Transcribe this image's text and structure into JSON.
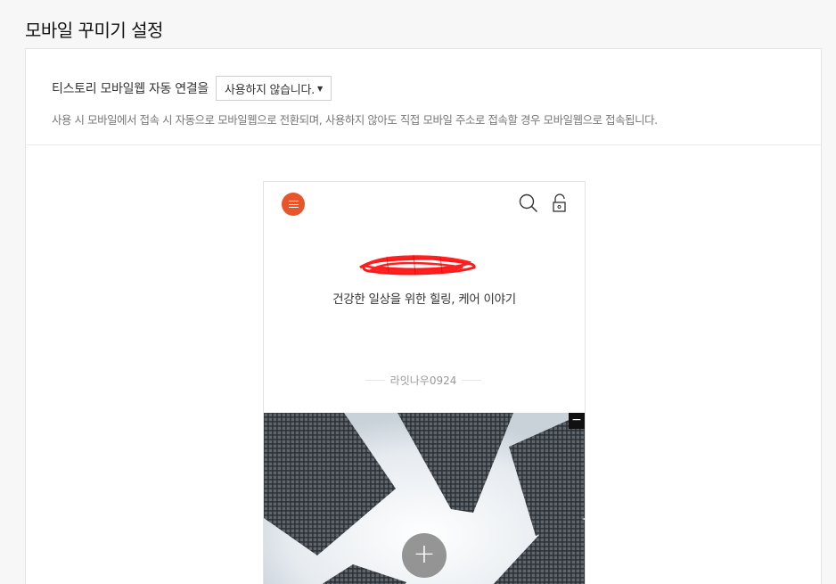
{
  "page": {
    "title": "모바일 꾸미기 설정"
  },
  "setting": {
    "label": "티스토리 모바일웹 자동 연결을",
    "select_value": "사용하지 않습니다.",
    "description": "사용 시 모바일에서 접속 시 자동으로 모바일웹으로 전환되며, 사용하지 않아도 직접 모바일 주소로 접속할 경우 모바일웹으로 접속됩니다."
  },
  "preview": {
    "blog_description": "건강한 일상을 위한 힐링, 케어 이야기",
    "author": "라잇나우0924",
    "accent": "#e8552a",
    "icons": [
      "menu-icon",
      "search-icon",
      "lock-icon",
      "minus-icon",
      "plus-icon"
    ],
    "collapse_label": "−",
    "add_label": "+"
  }
}
